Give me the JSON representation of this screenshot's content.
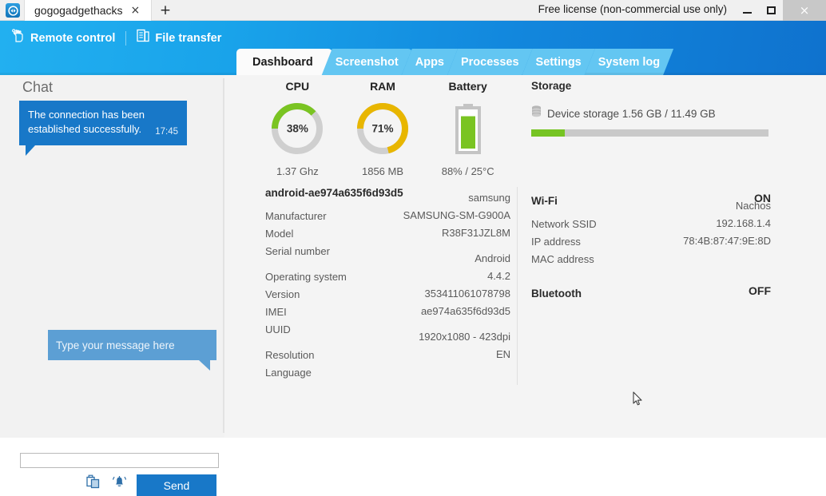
{
  "window": {
    "app_icon": "teamviewer-icon",
    "tab_title": "gogogadgethacks",
    "tab_close": "×",
    "new_tab": "+",
    "license": "Free license (non-commercial use only)",
    "minimize": "minimize-icon",
    "maximize": "maximize-icon",
    "close": "×"
  },
  "header": {
    "actions": [
      {
        "label": "Remote control",
        "icon": "hand-pointer-icon"
      },
      {
        "label": "File transfer",
        "icon": "file-transfer-icon"
      }
    ],
    "tabs": [
      {
        "label": "Dashboard",
        "active": true
      },
      {
        "label": "Screenshot",
        "active": false
      },
      {
        "label": "Apps",
        "active": false
      },
      {
        "label": "Processes",
        "active": false
      },
      {
        "label": "Settings",
        "active": false
      },
      {
        "label": "System log",
        "active": false
      }
    ]
  },
  "chat": {
    "title": "Chat",
    "message": "The connection has been established successfully.",
    "message_time": "17:45",
    "tooltip": "Type your message here",
    "input_value": "",
    "input_placeholder": "",
    "clipboard_icon": "clipboard-icon",
    "bell_icon": "bell-icon",
    "send_label": "Send"
  },
  "dashboard": {
    "gauges": [
      {
        "title": "CPU",
        "percent": 38,
        "display": "38%",
        "sub": "1.37 Ghz",
        "color": "#7ac422"
      },
      {
        "title": "RAM",
        "percent": 71,
        "display": "71%",
        "sub": "1856 MB",
        "color": "#e8b600"
      },
      {
        "title": "Battery",
        "percent": 88,
        "display": "",
        "sub": "88% / 25°C",
        "color": "#7ac422"
      }
    ],
    "device": {
      "heading": "android-ae974a635f6d93d5",
      "rows": [
        {
          "key": "Manufacturer",
          "value": "samsung"
        },
        {
          "key": "Model",
          "value": "SAMSUNG-SM-G900A"
        },
        {
          "key": "Serial number",
          "value": "R38F31JZL8M"
        },
        {
          "key": "Operating system",
          "value": "Android",
          "gap_before": true
        },
        {
          "key": "Version",
          "value": "4.4.2"
        },
        {
          "key": "IMEI",
          "value": "353411061078798"
        },
        {
          "key": "UUID",
          "value": "ae974a635f6d93d5"
        },
        {
          "key": "Resolution",
          "value": "1920x1080 - 423dpi",
          "gap_before": true
        },
        {
          "key": "Language",
          "value": "EN"
        }
      ]
    },
    "storage": {
      "heading": "Storage",
      "icon": "disk-stack-icon",
      "label": "Device storage 1.56 GB / 11.49 GB",
      "used_gb": 1.56,
      "total_gb": 11.49,
      "fill_percent": 14,
      "fill_color": "#76c423"
    },
    "wifi": {
      "heading": "Wi-Fi",
      "state": "ON",
      "rows": [
        {
          "key": "Network SSID",
          "value": "Nachos"
        },
        {
          "key": "IP address",
          "value": "192.168.1.4"
        },
        {
          "key": "MAC address",
          "value": "78:4B:87:47:9E:8D"
        }
      ]
    },
    "bluetooth": {
      "heading": "Bluetooth",
      "state": "OFF"
    }
  },
  "pointer": {
    "icon": "mouse-cursor-icon"
  }
}
